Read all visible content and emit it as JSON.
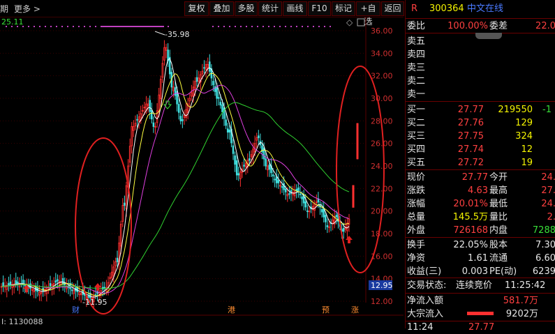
{
  "toolbar": {
    "period_label": "期",
    "more_label": "更多 >",
    "buttons": [
      "复权",
      "叠加",
      "多股",
      "统计",
      "画线",
      "F10",
      "标记",
      "+自选",
      "返回"
    ]
  },
  "chart": {
    "ma_value": "25.11",
    "right_axis_labels": [
      "36.00",
      "34.00",
      "32.00",
      "30.00",
      "28.00",
      "26.00",
      "24.00",
      "22.00",
      "20.00",
      "18.00",
      "16.00",
      "14.00",
      "12.00"
    ],
    "current_price_tag": "12.95",
    "high_annotation": "35.98",
    "low_annotation": "11.95",
    "volume_label": "I: 1130088",
    "event_markers": [
      "财",
      "港",
      "预",
      "涨"
    ],
    "colors": {
      "up": "#ff3030",
      "down": "#40e0e0",
      "ma5": "#ffffff",
      "ma10": "#ffff40",
      "ma20": "#e040e0",
      "ma60": "#30d030",
      "annotation": "#e02020"
    }
  },
  "quote": {
    "badge": "R",
    "code": "300364",
    "name": "中文在线",
    "weibi_label": "委比",
    "weibi_value": "100.00%",
    "weicha_label": "委差",
    "weicha_value": "22.0",
    "sell": [
      {
        "label": "卖五"
      },
      {
        "label": "卖四"
      },
      {
        "label": "卖三"
      },
      {
        "label": "卖二"
      },
      {
        "label": "卖一"
      }
    ],
    "buy": [
      {
        "label": "买一",
        "price": "27.77",
        "vol": "219550",
        "extra": "-1"
      },
      {
        "label": "买二",
        "price": "27.76",
        "vol": "129",
        "extra": ""
      },
      {
        "label": "买三",
        "price": "27.75",
        "vol": "324",
        "extra": ""
      },
      {
        "label": "买四",
        "price": "27.74",
        "vol": "12",
        "extra": ""
      },
      {
        "label": "买五",
        "price": "27.72",
        "vol": "19",
        "extra": ""
      }
    ],
    "stats": [
      {
        "l1": "现价",
        "v1": "27.77",
        "l2": "今开",
        "v2": "24."
      },
      {
        "l1": "涨跌",
        "v1": "4.63",
        "l2": "最高",
        "v2": "27."
      },
      {
        "l1": "涨幅",
        "v1": "20.01%",
        "l2": "最低",
        "v2": "24."
      },
      {
        "l1": "总量",
        "v1": "145.5万",
        "l2": "量比",
        "v2": "2."
      },
      {
        "l1": "外盘",
        "v1": "726168",
        "l2": "内盘",
        "v2": "7288"
      }
    ],
    "stats2": [
      {
        "l1": "换手",
        "v1": "22.05%",
        "l2": "股本",
        "v2": "7.30"
      },
      {
        "l1": "净资",
        "v1": "1.61",
        "l2": "流通",
        "v2": "6.60"
      },
      {
        "l1": "收益(三)",
        "v1": "0.003",
        "l2": "PE(动)",
        "v2": "6239"
      }
    ],
    "status_label": "交易状态:",
    "status_value": "连续竞价",
    "status_time": "11:25:42",
    "inflow_label": "净流入额",
    "inflow_value": "581.7万",
    "bulk_label": "大宗流入",
    "bulk_value": "9202万",
    "bottom_time": "11:24",
    "bottom_price": "27.77"
  }
}
